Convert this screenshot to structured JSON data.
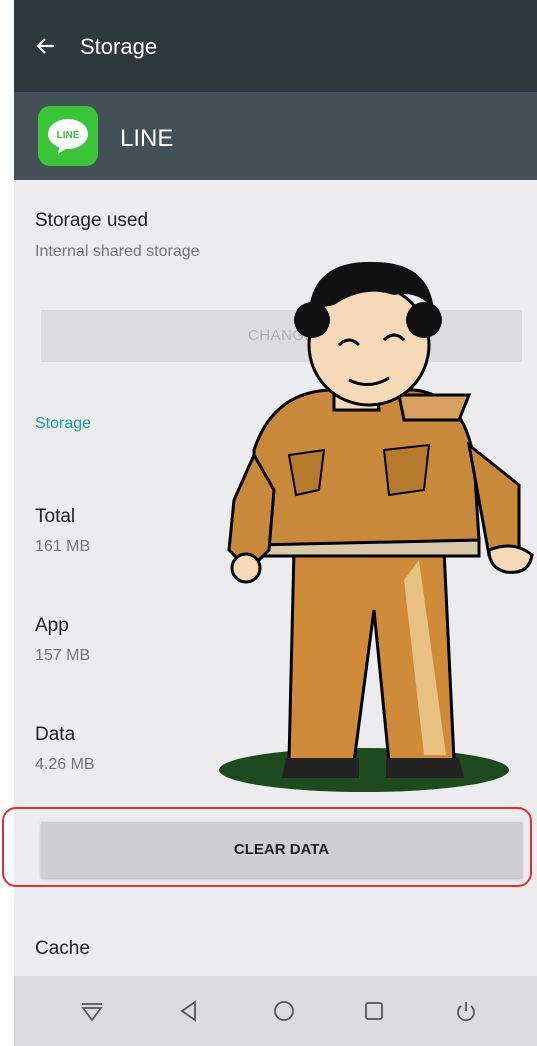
{
  "toolbar": {
    "title": "Storage"
  },
  "app": {
    "name": "LINE",
    "icon_label": "LINE",
    "icon": "line-app-icon",
    "icon_color": "#3ac43a"
  },
  "storage_used": {
    "title": "Storage used",
    "subtitle": "Internal shared storage",
    "change_label": "CHANGE"
  },
  "section": {
    "title": "Storage"
  },
  "stats": {
    "total": {
      "label": "Total",
      "value": "161 MB"
    },
    "app": {
      "label": "App",
      "value": "157 MB"
    },
    "data": {
      "label": "Data",
      "value": "4.26 MB"
    },
    "cache": {
      "label": "Cache",
      "value": ""
    }
  },
  "actions": {
    "clear_data_label": "CLEAR DATA"
  },
  "nav": {
    "icons": [
      "chevron-down-icon",
      "back-triangle-icon",
      "home-circle-icon",
      "recents-square-icon",
      "power-icon"
    ]
  },
  "colors": {
    "toolbar": "#2f383c",
    "appbar": "#435058",
    "accent": "#1aa19a",
    "highlight": "#e03232"
  }
}
